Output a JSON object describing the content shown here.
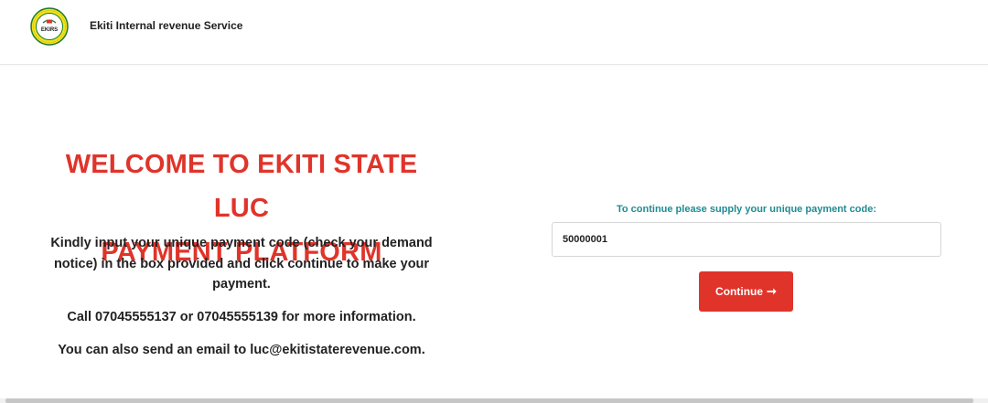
{
  "header": {
    "logo": {
      "text": "EKIRS",
      "ring_text": "EKITI STATE INTERNAL REVENUE SERVICE"
    },
    "brand": "Ekiti Internal revenue Service"
  },
  "hero": {
    "title_line1": "WELCOME TO EKITI STATE LUC",
    "title_line2": "PAYMENT PLATFORM",
    "instructions": "Kindly input your unique payment code (check your demand notice) in the box provided and click continue to make your payment.",
    "phone_line": "Call 07045555137 or 07045555139 for more information.",
    "email_line": "You can also send an email to luc@ekitistaterevenue.com."
  },
  "form": {
    "label": "To continue please supply your unique payment code:",
    "input_value": "50000001",
    "continue_label": "Continue",
    "continue_icon": "arrow-right-icon"
  },
  "colors": {
    "accent_red": "#e0342a",
    "label_teal": "#1f8c93",
    "logo_yellow": "#f2e21c",
    "logo_green": "#1d7a2c"
  }
}
